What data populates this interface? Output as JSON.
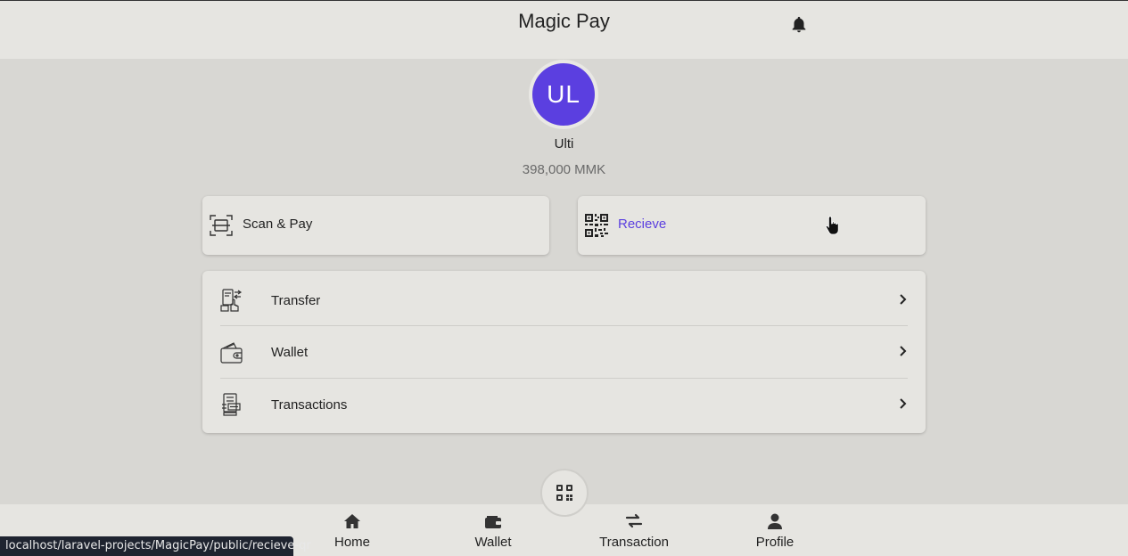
{
  "header": {
    "title": "Magic Pay",
    "notification_icon": "bell-icon"
  },
  "profile": {
    "initials": "UL",
    "name": "Ulti",
    "balance": "398,000 MMK",
    "avatar_color": "#5b3fe0"
  },
  "quick_actions": {
    "scan": {
      "label": "Scan & Pay",
      "icon": "scan-icon"
    },
    "receive": {
      "label": "Recieve",
      "icon": "qr-code-icon",
      "accent": "#5b3fe0"
    }
  },
  "menu": [
    {
      "label": "Transfer",
      "icon": "transfer-icon"
    },
    {
      "label": "Wallet",
      "icon": "wallet-icon"
    },
    {
      "label": "Transactions",
      "icon": "transactions-icon"
    }
  ],
  "bottom_nav": [
    {
      "label": "Home",
      "icon": "home-icon"
    },
    {
      "label": "Wallet",
      "icon": "wallet-icon"
    },
    {
      "label": "Transaction",
      "icon": "transaction-icon"
    },
    {
      "label": "Profile",
      "icon": "profile-icon"
    }
  ],
  "fab": {
    "icon": "qr-code-icon"
  },
  "status_url": "localhost/laravel-projects/MagicPay/public/recieve-qr"
}
